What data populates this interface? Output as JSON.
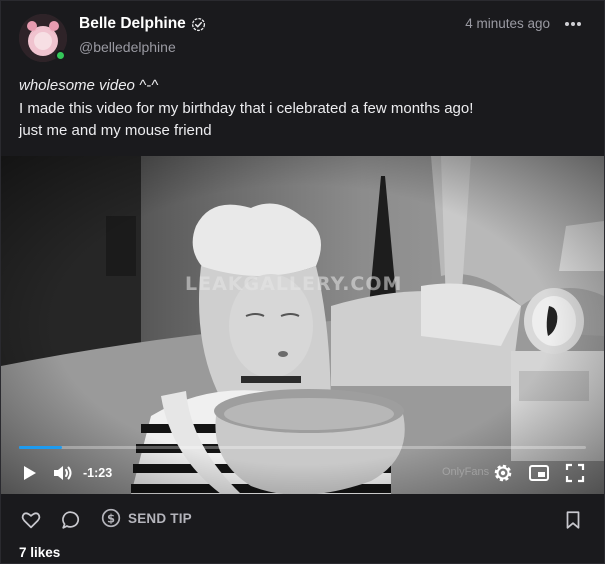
{
  "post": {
    "author_name": "Belle Delphine",
    "author_handle": "@belledelphine",
    "timestamp": "4 minutes ago",
    "caption_line1": "wholesome video ^-^",
    "caption_line2": "I made this video for my birthday that i celebrated a few months ago!",
    "caption_line3": "just me and my mouse friend"
  },
  "video": {
    "watermark": "LEAKGALLERY.COM",
    "overlay_text": "OnlyFans",
    "time_remaining": "-1:23",
    "progress_fraction": 0.075
  },
  "actions": {
    "send_tip_label": "SEND TIP",
    "likes": "7 likes"
  },
  "colors": {
    "accent": "#1d9bf0",
    "online": "#34c759"
  },
  "icons": [
    "verified-icon",
    "more-icon",
    "play-icon",
    "volume-icon",
    "settings-icon",
    "pip-icon",
    "fullscreen-icon",
    "heart-icon",
    "comment-icon",
    "dollar-icon",
    "bookmark-icon"
  ]
}
